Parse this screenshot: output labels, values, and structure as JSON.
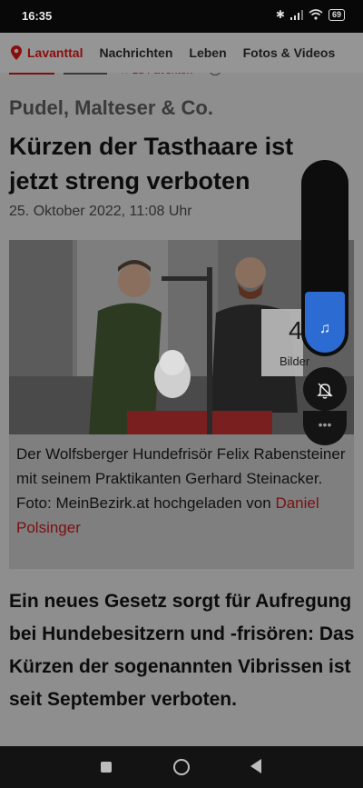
{
  "status": {
    "time": "16:35",
    "battery": "69"
  },
  "nav": {
    "location": "Lavanttal",
    "items": [
      "Nachrichten",
      "Leben",
      "Fotos & Videos"
    ]
  },
  "strip": {
    "favorites": "zu Favoriten",
    "info": "i"
  },
  "article": {
    "kicker": "Pudel, Malteser & Co.",
    "headline": "Kürzen der Tasthaare ist jetzt streng verboten",
    "date": "25. Oktober 2022, 11:08 Uhr",
    "caption": "Der Wolfsberger Hundefrisör Felix Rabensteiner mit seinem Praktikanten Gerhard Steinacker.",
    "photo_credit": "Foto: MeinBezirk.at",
    "uploaded_by_label": "hochgeladen von",
    "uploader": "Daniel Polsinger",
    "lead": "Ein neues Gesetz sorgt für Aufregung bei Hundebesitzern und -frisören: Das Kürzen der sogenannten Vibrissen ist seit September verboten."
  },
  "gallery": {
    "count": "4",
    "label": "Bilder"
  },
  "volume_panel": {
    "level": 0.32,
    "stream_icon": "music-note-icon",
    "ringer_icon": "bell-off-icon",
    "accent": "#2c6bd1"
  },
  "colors": {
    "brand_red": "#8a0d0d"
  }
}
